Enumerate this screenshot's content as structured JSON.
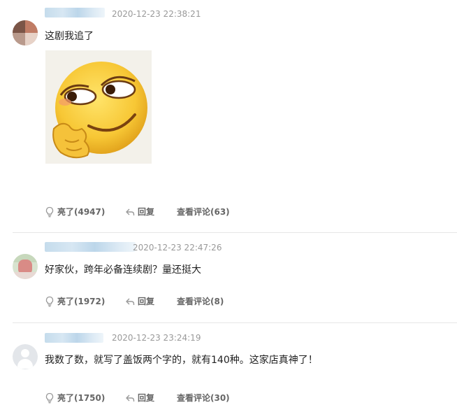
{
  "comments": [
    {
      "timestamp": "2020-12-23 22:38:21",
      "text": "这剧我追了",
      "actions": {
        "like": "亮了(4947)",
        "reply": "回复",
        "view_replies": "查看评论(63)"
      },
      "has_image": true,
      "image_icon": "side-eye-smirk-emoji"
    },
    {
      "timestamp": "2020-12-23 22:47:26",
      "text": "好家伙，跨年必备连续剧？量还挺大",
      "actions": {
        "like": "亮了(1972)",
        "reply": "回复",
        "view_replies": "查看评论(8)"
      }
    },
    {
      "timestamp": "2020-12-23 23:24:19",
      "text": "我数了数，就写了盖饭两个字的，就有140种。这家店真神了！",
      "actions": {
        "like": "亮了(1750)",
        "reply": "回复",
        "view_replies": "查看评论(30)"
      }
    }
  ],
  "icons": {
    "like": "lightbulb-icon",
    "reply": "reply-arrow-icon"
  },
  "colors": {
    "text": "#222222",
    "meta": "#999999",
    "action": "#666666",
    "divider": "#e6e6e6",
    "username_blur": "#c5dcec"
  }
}
